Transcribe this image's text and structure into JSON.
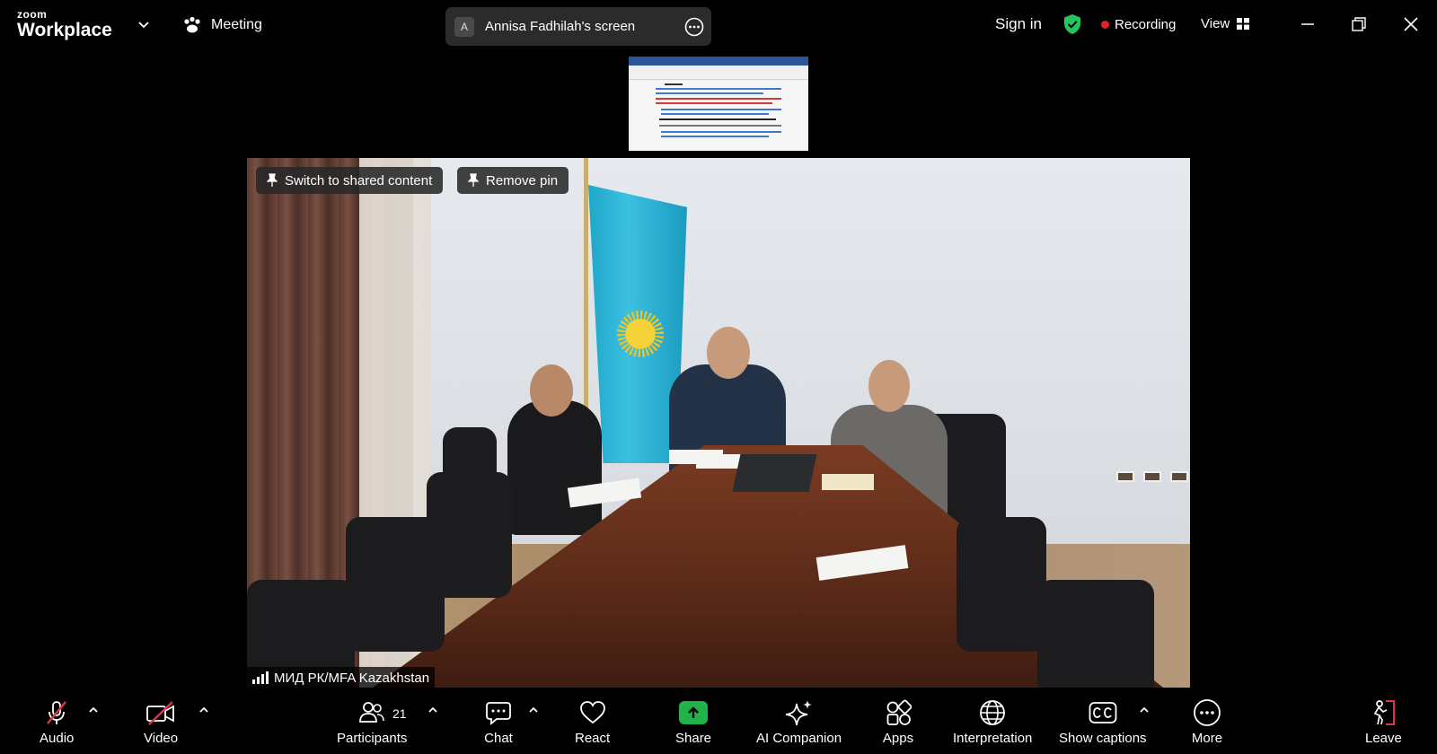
{
  "app": {
    "logo_top": "zoom",
    "logo_bottom": "Workplace",
    "meeting_label": "Meeting"
  },
  "share_pill": {
    "avatar_letter": "A",
    "title": "Annisa Fadhilah's screen"
  },
  "header": {
    "sign_in": "Sign in",
    "recording": "Recording",
    "view": "View"
  },
  "video": {
    "pin_switch": "Switch to shared content",
    "remove_pin": "Remove pin",
    "participant_name": "МИД РК/MFA Kazakhstan"
  },
  "toolbar": {
    "audio": "Audio",
    "video": "Video",
    "participants": "Participants",
    "participant_count": "21",
    "chat": "Chat",
    "react": "React",
    "share": "Share",
    "ai_companion": "AI Companion",
    "apps": "Apps",
    "interpretation": "Interpretation",
    "show_captions": "Show captions",
    "more": "More",
    "leave": "Leave"
  },
  "colors": {
    "recording_dot": "#e02424",
    "share_green": "#21b24b",
    "shield_green": "#22c55e",
    "muted_red": "#e0344a",
    "leave_red": "#e0344a"
  },
  "icons": [
    "chevron-down-icon",
    "paw-icon",
    "more-icon",
    "shield-check-icon",
    "grid-icon",
    "minimize-icon",
    "restore-icon",
    "close-icon",
    "pin-icon",
    "signal-icon",
    "mic-off-icon",
    "video-off-icon",
    "participants-icon",
    "chat-icon",
    "heart-icon",
    "share-up-icon",
    "sparkle-icon",
    "apps-icon",
    "globe-icon",
    "cc-icon",
    "more-icon",
    "leave-icon"
  ]
}
